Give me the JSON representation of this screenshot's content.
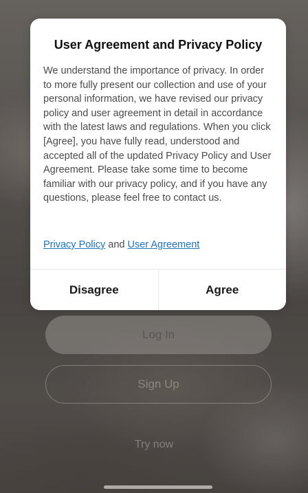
{
  "dialog": {
    "title": "User Agreement and Privacy Policy",
    "body": "We understand the importance of privacy. In order to more fully present our collection and use of your personal information, we have revised our privacy policy and user agreement in detail in accordance with the latest laws and regulations. When you click [Agree], you have fully read, understood and accepted all of the updated Privacy Policy and User Agreement. Please take some time to become familiar with our privacy policy, and if you have any questions, please feel free to contact us.",
    "privacy_link": "Privacy Policy",
    "and_text": "and",
    "agreement_link": "User Agreement",
    "disagree_label": "Disagree",
    "agree_label": "Agree"
  },
  "screen": {
    "login_label": "Log In",
    "signup_label": "Sign Up",
    "try_now_label": "Try now"
  },
  "colors": {
    "link": "#1a73c7",
    "dialog_bg": "#ffffff",
    "title": "#111111",
    "body_text": "#4a4a4a"
  }
}
